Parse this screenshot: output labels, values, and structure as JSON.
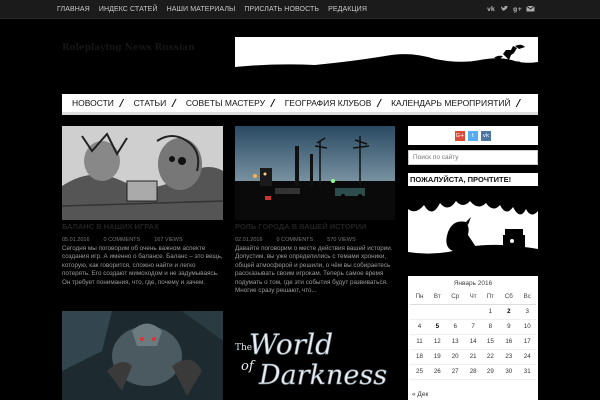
{
  "topnav": [
    "ГЛАВНАЯ",
    "ИНДЕКС СТАТЕЙ",
    "НАШИ МАТЕРИАЛЫ",
    "ПРИСЛАТЬ НОВОСТЬ",
    "РЕДАКЦИЯ"
  ],
  "social_icons": [
    "vk-icon",
    "twitter-icon",
    "google-plus-icon",
    "email-icon"
  ],
  "site_title": "Roleplaying News Russian",
  "mainnav": [
    "НОВОСТИ",
    "СТАТЬИ",
    "СОВЕТЫ МАСТЕРУ",
    "ГЕОГРАФИЯ КЛУБОВ",
    "КАЛЕНДАРЬ МЕРОПРИЯТИЙ"
  ],
  "posts": [
    {
      "title": "БАЛАНС В НАШИХ ИГРАХ",
      "date": "05.01.2016",
      "comments": "0 COMMENTS",
      "views": "167 VIEWS",
      "excerpt": "Сегодня мы поговорим об очень важном аспекте создания игр. А именно о балансе. Баланс – это вещь, которую, как говорится, сложно найти и легко потерять. Его создают мимоходом и не задумываясь. Он требует понимания, что, где, почему и зачем."
    },
    {
      "title": "РОЛЬ ГОРОДА В ВАШЕЙ ИСТОРИИ",
      "date": "02.01.2016",
      "comments": "0 COMMENTS",
      "views": "570 VIEWS",
      "excerpt": "Давайте поговорим о месте действия вашей истории. Допустим, вы уже определились с темами хроники, общей атмосферой и решили, о чём вы собираетесь рассказывать своим игрокам. Теперь самое время подумать о том, где эти события будут развиваться. Многие сразу решают, что..."
    }
  ],
  "wod_logo": "The World of Darkness",
  "share_icons": [
    "G+",
    "t",
    "vk"
  ],
  "share_colors": [
    "#dd4b39",
    "#55acee",
    "#4c75a3"
  ],
  "search_placeholder": "Поиск по сайту",
  "please_read": "ПОЖАЛУЙСТА, ПРОЧТИТЕ!",
  "calendar": {
    "caption": "Январь 2016",
    "weekdays": [
      "Пн",
      "Вт",
      "Ср",
      "Чт",
      "Пт",
      "Сб",
      "Вс"
    ],
    "weeks": [
      [
        "",
        "",
        "",
        "",
        "1",
        "2",
        "3"
      ],
      [
        "4",
        "5",
        "6",
        "7",
        "8",
        "9",
        "10"
      ],
      [
        "11",
        "12",
        "13",
        "14",
        "15",
        "16",
        "17"
      ],
      [
        "18",
        "19",
        "20",
        "21",
        "22",
        "23",
        "24"
      ],
      [
        "25",
        "26",
        "27",
        "28",
        "29",
        "30",
        "31"
      ]
    ],
    "bold_days": [
      "2",
      "5"
    ],
    "prev": "« Дек"
  }
}
